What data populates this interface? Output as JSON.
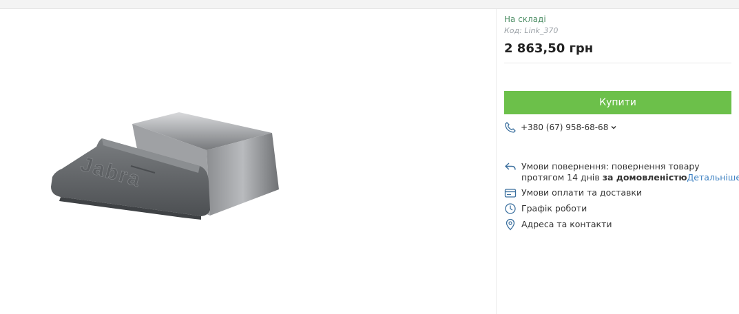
{
  "product": {
    "stock_status": "На складі",
    "code": "Код: Link_370",
    "price": "2 863,50 грн",
    "image_brand_text": "Jabra"
  },
  "actions": {
    "buy_label": "Купити"
  },
  "contacts": {
    "phone": "+380 (67) 958-68-68"
  },
  "info_links": {
    "returns_line1": "Умови повернення: повернення товару",
    "returns_line2_prefix": "протягом 14 днів ",
    "returns_line2_bold": "за домовленістю",
    "returns_more": "Детальніше",
    "payment_delivery": "Умови оплати та доставки",
    "schedule": "Графік роботи",
    "address": "Адреса та контакти"
  },
  "icons": [
    "phone-icon",
    "chevron-down-icon",
    "return-arrow-icon",
    "card-icon",
    "clock-icon",
    "location-pin-icon"
  ],
  "colors": {
    "buy_button": "#6cc04a",
    "stock": "#4e8f66",
    "link": "#3a7fc1",
    "icon": "#3a6f9e"
  }
}
